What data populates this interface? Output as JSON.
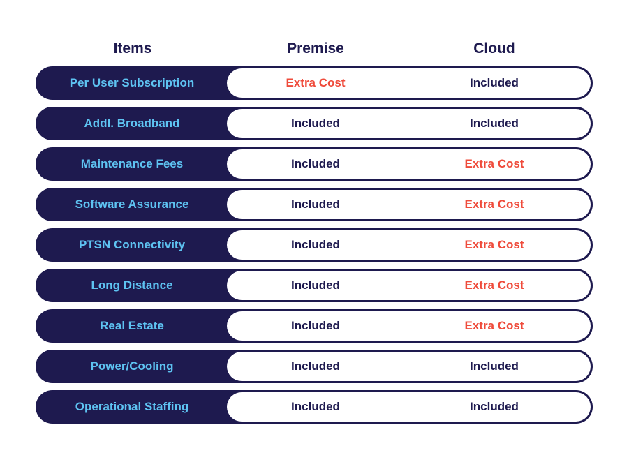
{
  "headers": {
    "items": "Items",
    "premise": "Premise",
    "cloud": "Cloud"
  },
  "colors": {
    "navy": "#1e1a4f",
    "item_text": "#5ec3f2",
    "extra_cost": "#ef4b3b"
  },
  "rows": [
    {
      "item": "Per User Subscription",
      "premise": "Extra Cost",
      "cloud": "Included"
    },
    {
      "item": "Addl. Broadband",
      "premise": "Included",
      "cloud": "Included"
    },
    {
      "item": "Maintenance Fees",
      "premise": "Included",
      "cloud": "Extra Cost"
    },
    {
      "item": "Software Assurance",
      "premise": "Included",
      "cloud": "Extra Cost"
    },
    {
      "item": "PTSN Connectivity",
      "premise": "Included",
      "cloud": "Extra Cost"
    },
    {
      "item": "Long Distance",
      "premise": "Included",
      "cloud": "Extra Cost"
    },
    {
      "item": "Real Estate",
      "premise": "Included",
      "cloud": "Extra Cost"
    },
    {
      "item": "Power/Cooling",
      "premise": "Included",
      "cloud": "Included"
    },
    {
      "item": "Operational Staffing",
      "premise": "Included",
      "cloud": "Included"
    }
  ]
}
